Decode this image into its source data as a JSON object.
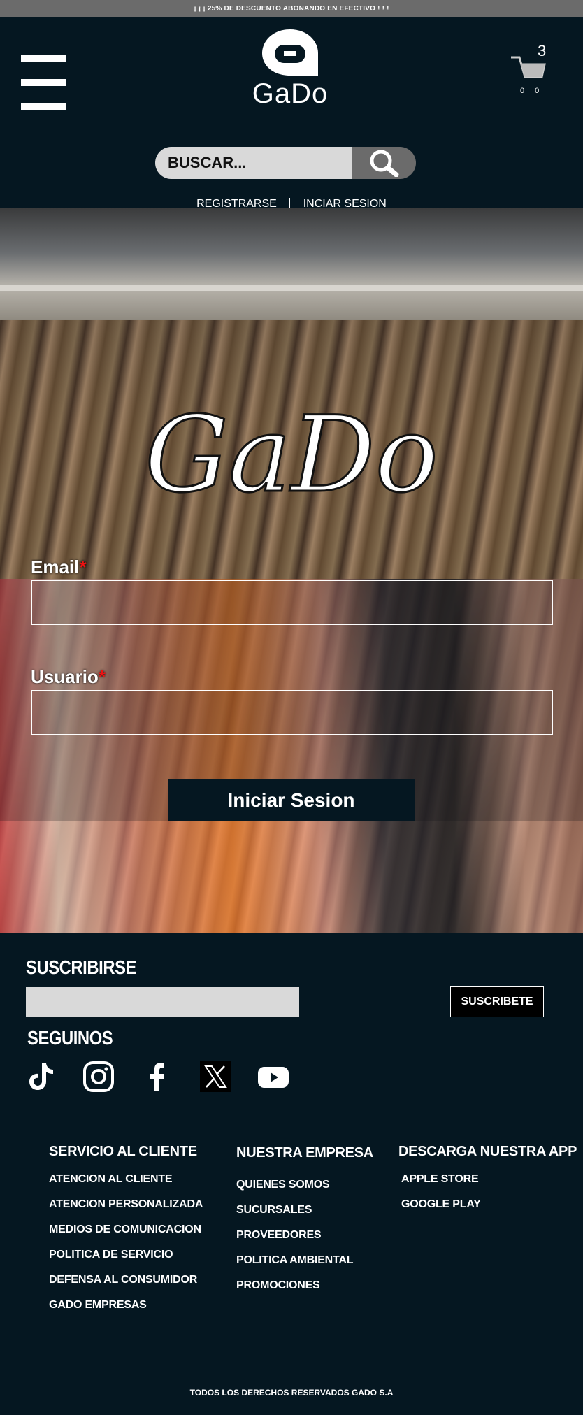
{
  "promo_bar": {
    "text": "¡ ¡ ¡ 25% DE DESCUENTO ABONANDO EN EFECTIVO ! ! !"
  },
  "header": {
    "logo_text": "GaDo",
    "cart": {
      "count": "3",
      "sub": "0 0"
    },
    "search": {
      "placeholder": "BUSCAR..."
    },
    "register_label": "REGISTRARSE",
    "login_label": "INCIAR SESION"
  },
  "hero": {
    "brand_script": "GaDo",
    "email_label": "Email",
    "user_label": "Usuario",
    "required_mark": "*",
    "login_button": "Iniciar Sesion"
  },
  "footer": {
    "subscribe_title": "SUSCRIBIRSE",
    "subscribe_button": "SUSCRIBETE",
    "follow_title": "SEGUINOS",
    "social_icons": [
      "tiktok-icon",
      "instagram-icon",
      "facebook-icon",
      "x-icon",
      "youtube-icon"
    ],
    "columns": [
      {
        "title": "SERVICIO AL CLIENTE",
        "links": [
          "ATENCION AL CLIENTE",
          "ATENCION PERSONALIZADA",
          "MEDIOS DE COMUNICACION",
          "POLITICA DE SERVICIO",
          "DEFENSA AL CONSUMIDOR",
          "GADO EMPRESAS"
        ]
      },
      {
        "title": "NUESTRA EMPRESA",
        "links": [
          "QUIENES SOMOS",
          "SUCURSALES",
          "PROVEEDORES",
          "POLITICA AMBIENTAL",
          "PROMOCIONES"
        ]
      },
      {
        "title": "DESCARGA NUESTRA APP",
        "links": [
          "APPLE STORE",
          "GOOGLE PLAY"
        ]
      }
    ],
    "copyright": "TODOS LOS DERECHOS RESERVADOS GADO S.A"
  },
  "colors": {
    "background": "#051721",
    "promo_bar": "#6b6b6b",
    "search_field": "#d9d9d9",
    "required": "#e11111"
  }
}
